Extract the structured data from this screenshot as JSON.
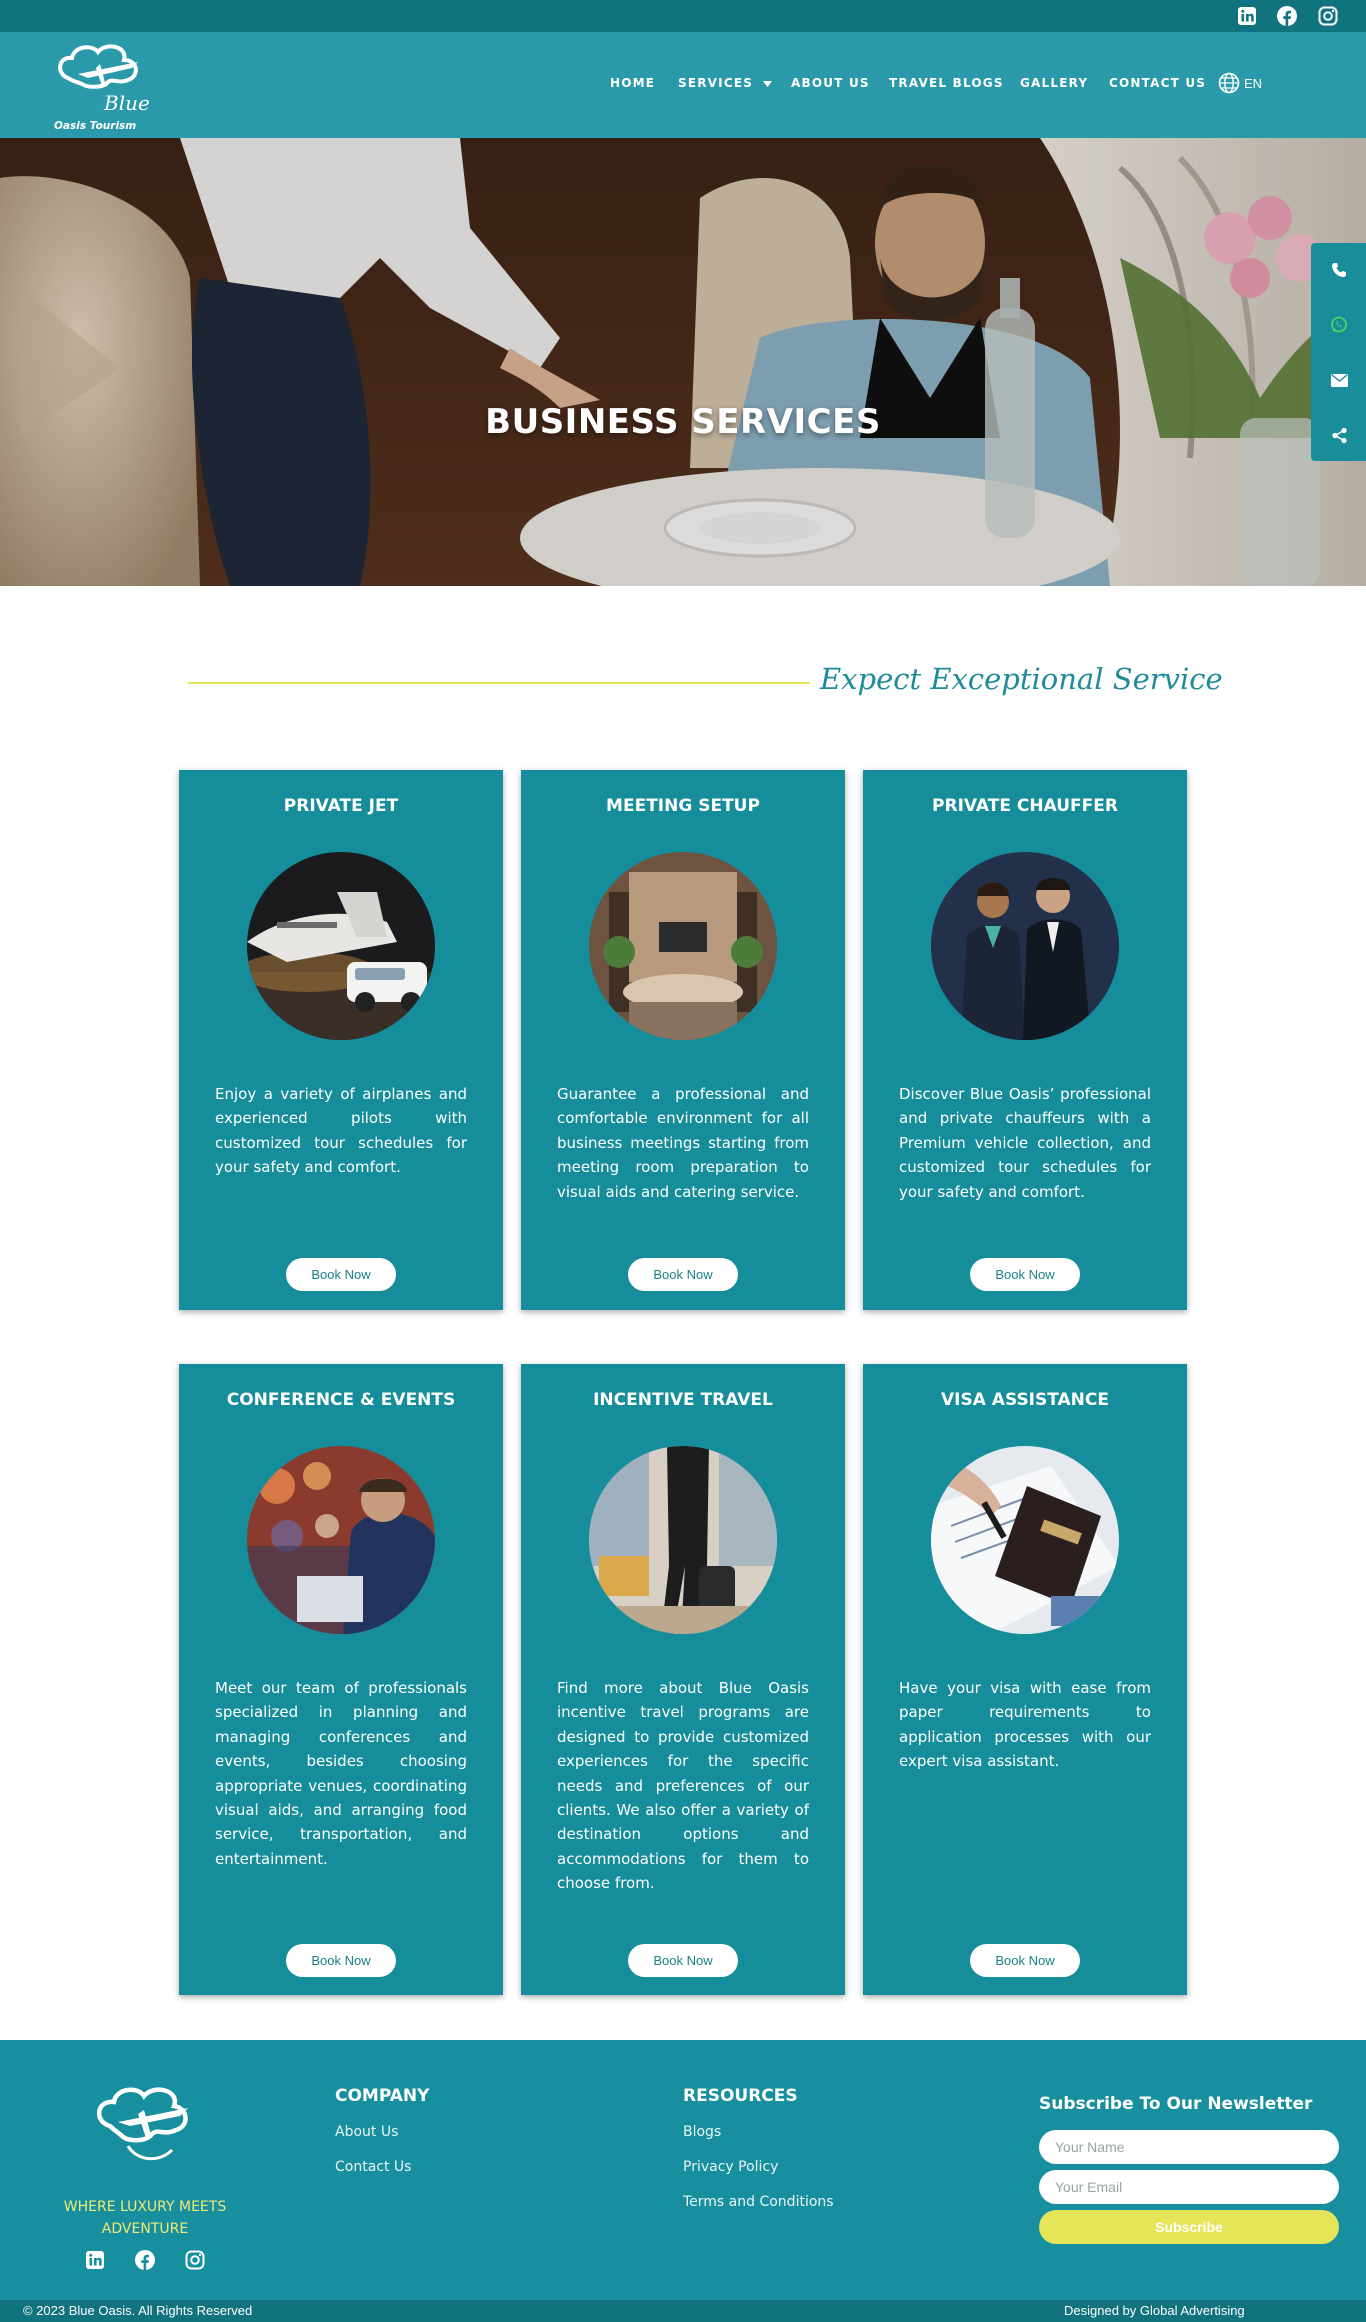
{
  "nav": {
    "items": [
      {
        "label": "HOME"
      },
      {
        "label": "SERVICES"
      },
      {
        "label": "ABOUT US"
      },
      {
        "label": "TRAVEL BLOGS"
      },
      {
        "label": "GALLERY"
      },
      {
        "label": "CONTACT US"
      }
    ],
    "language": "EN"
  },
  "hero": {
    "title": "BUSINESS SERVICES"
  },
  "section": {
    "heading": "Expect Exceptional Service"
  },
  "cards": [
    {
      "title": "PRIVATE JET",
      "text": "Enjoy a variety of airplanes and experienced pilots with customized tour schedules for your safety and comfort.",
      "button": "Book Now"
    },
    {
      "title": "MEETING SETUP",
      "text": "Guarantee a professional and comfortable environment for all business meetings starting from meeting room preparation to visual aids and catering service.",
      "button": "Book Now"
    },
    {
      "title": "PRIVATE CHAUFFER",
      "text": "Discover Blue Oasis’ professional and private chauffeurs with a Premium vehicle collection, and customized tour schedules for your safety and comfort.",
      "button": "Book Now"
    },
    {
      "title": "CONFERENCE & EVENTS",
      "text": "Meet our team of professionals specialized in planning and managing conferences and events, besides choosing appropriate venues, coordinating visual aids, and arranging food service, transportation, and entertainment.",
      "button": "Book Now"
    },
    {
      "title": "INCENTIVE TRAVEL",
      "text": "Find more about Blue Oasis incentive travel programs are designed to provide customized experiences for the specific needs and preferences of our clients. We also offer a variety of destination options and accommodations for them to choose from.",
      "button": "Book Now"
    },
    {
      "title": "VISA ASSISTANCE",
      "text": "Have your visa with ease from paper requirements to application processes with our expert visa assistant.",
      "button": "Book Now"
    }
  ],
  "footer": {
    "tagline": "WHERE LUXURY MEETS ADVENTURE",
    "company": {
      "heading": "COMPANY",
      "links": [
        "About Us",
        "Contact Us"
      ]
    },
    "resources": {
      "heading": "RESOURCES",
      "links": [
        "Blogs",
        "Privacy Policy",
        "Terms and Conditions"
      ]
    },
    "newsletter": {
      "heading": "Subscribe To Our Newsletter",
      "name_placeholder": "Your Name",
      "email_placeholder": "Your Email",
      "button": "Subscribe"
    },
    "copyright": "© 2023 Blue Oasis. All Rights Reserved",
    "credit": "Designed by Global Advertising"
  },
  "logo": {
    "line1": "Blue",
    "line2": "Oasis Tourism"
  },
  "icons": {
    "social": [
      "linkedin-icon",
      "facebook-icon",
      "instagram-icon"
    ],
    "floating": [
      "phone-icon",
      "whatsapp-icon",
      "mail-icon",
      "share-icon"
    ]
  },
  "colors": {
    "primary": "#158d9b",
    "dark": "#11737d",
    "accent": "#e6e55a",
    "whatsapp": "#4fd16a"
  }
}
